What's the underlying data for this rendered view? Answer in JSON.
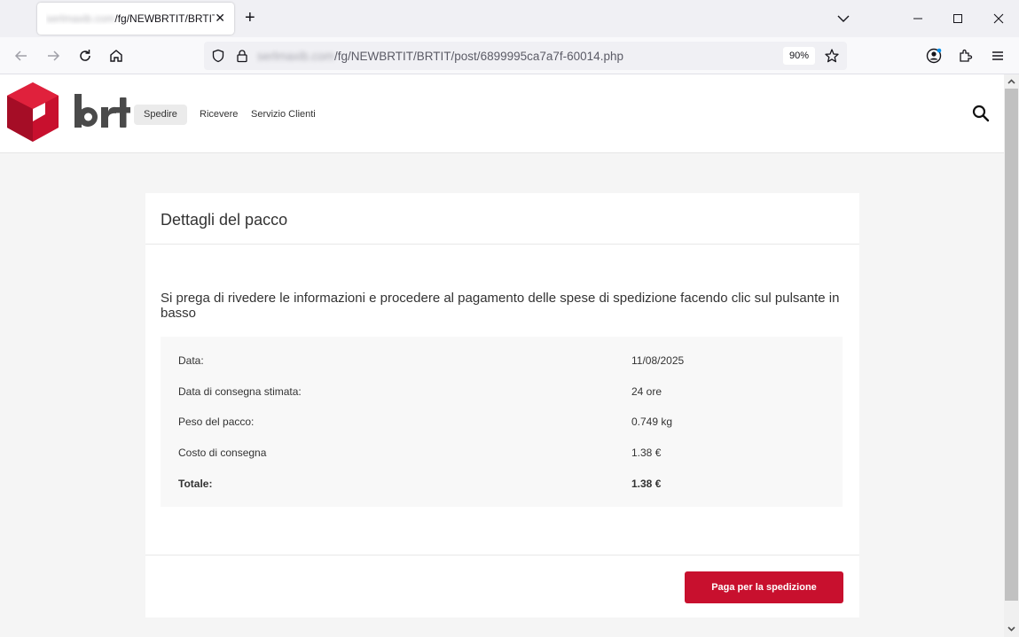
{
  "browser": {
    "tab": {
      "title_blurred": "serlmaxib.com",
      "title_visible": "/fg/NEWBRTIT/BRTIT",
      "close_glyph": "✕"
    },
    "new_tab_glyph": "+",
    "url": {
      "blurred_host": "serlmaxib.com",
      "path": "/fg/NEWBRTIT/BRTIT/post/6899995ca7a7f-60014.php"
    },
    "zoom": "90%"
  },
  "site": {
    "logo_text": "brt",
    "nav": [
      "Spedire",
      "Ricevere",
      "Servizio Clienti"
    ]
  },
  "card": {
    "title": "Dettagli del pacco",
    "intro": "Si prega di rivedere le informazioni e procedere al pagamento delle spese di spedizione facendo clic sul pulsante in basso",
    "rows": [
      {
        "label": "Data:",
        "value": "11/08/2025"
      },
      {
        "label": "Data di consegna stimata:",
        "value": "24 ore"
      },
      {
        "label": "Peso del pacco:",
        "value": "0.749 kg"
      },
      {
        "label": "Costo di consegna",
        "value": "1.38 €"
      },
      {
        "label": "Totale:",
        "value": "1.38 €"
      }
    ],
    "pay_button": "Paga per la spedizione"
  },
  "colors": {
    "brand_red": "#c8102e",
    "logo_gray": "#4a4a4a"
  }
}
